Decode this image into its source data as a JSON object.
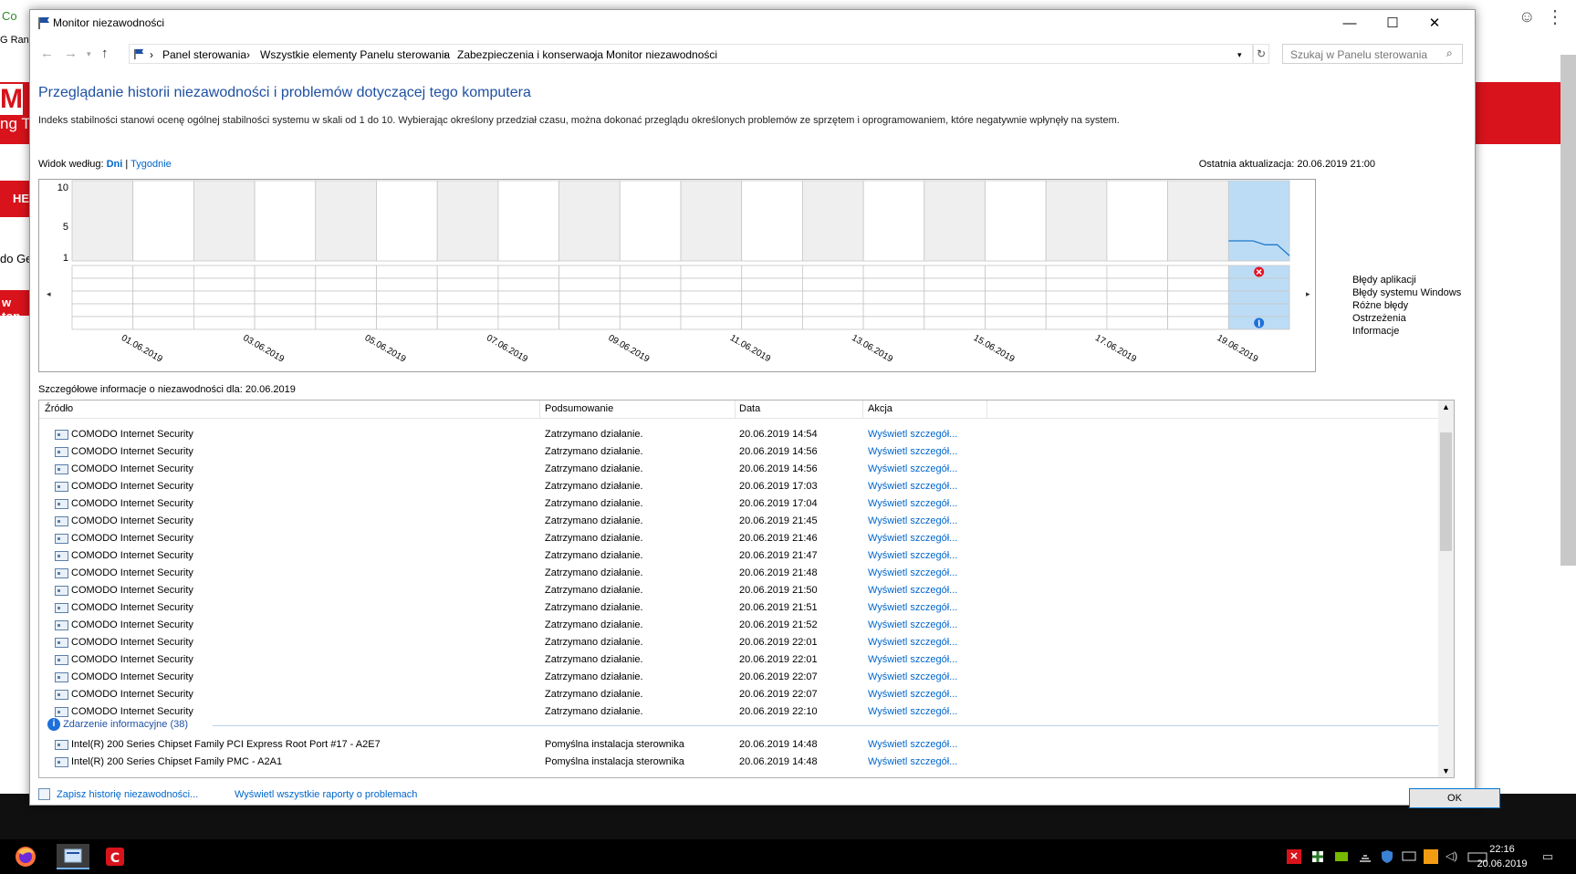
{
  "background": {
    "frag_tab": "Co",
    "frag_ran": "G Ran",
    "frag_ng": "ng T",
    "frag_he": "HE",
    "frag_do": "do Ge",
    "frag_top": "w top",
    "frag_m": "M"
  },
  "window": {
    "title": "Monitor niezawodności",
    "minimize": "—",
    "maximize": "☐",
    "close": "✕"
  },
  "address": {
    "crumbs": [
      "Panel sterowania",
      "Wszystkie elementy Panelu sterowania",
      "Zabezpieczenia i konserwacja",
      "Monitor niezawodności"
    ],
    "search_placeholder": "Szukaj w Panelu sterowania"
  },
  "page": {
    "heading": "Przeglądanie historii niezawodności i problemów dotyczącej tego komputera",
    "description": "Indeks stabilności stanowi ocenę ogólnej stabilności systemu w skali od 1 do 10. Wybierając określony przedział czasu, można dokonać przeglądu określonych problemów ze sprzętem i oprogramowaniem, które negatywnie wpłynęły na system.",
    "view_by_label": "Widok według:",
    "view_days": "Dni",
    "view_sep": "|",
    "view_weeks": "Tygodnie",
    "last_update": "Ostatnia aktualizacja: 20.06.2019 21:00"
  },
  "chart_data": {
    "type": "line",
    "title": "",
    "y_ticks": [
      "10",
      "5",
      "1"
    ],
    "ylim": [
      1,
      10
    ],
    "x_tick_labels": [
      "01.06.2019",
      "03.06.2019",
      "05.06.2019",
      "07.06.2019",
      "09.06.2019",
      "11.06.2019",
      "13.06.2019",
      "15.06.2019",
      "17.06.2019",
      "19.06.2019"
    ],
    "columns": 20,
    "selected_column": 19,
    "series": [
      {
        "x": [
          19.0,
          19.4,
          19.6,
          19.8,
          20.0
        ],
        "values": [
          3.1,
          3.1,
          2.6,
          2.6,
          1.2
        ]
      }
    ],
    "event_rows": [
      "Błędy aplikacji",
      "Błędy systemu Windows",
      "Różne błędy",
      "Ostrzeżenia",
      "Informacje"
    ],
    "markers": [
      {
        "row": 0,
        "column": 19,
        "kind": "error"
      },
      {
        "row": 4,
        "column": 19,
        "kind": "info"
      }
    ],
    "colors": {
      "selected": "#bcdcf6",
      "line": "#1f78c8",
      "error": "#e81123",
      "info": "#1e6fd9"
    }
  },
  "details": {
    "label": "Szczegółowe informacje o niezawodności dla: 20.06.2019",
    "headers": [
      "Źródło",
      "Podsumowanie",
      "Data",
      "Akcja"
    ],
    "rows": [
      {
        "source": "COMODO Internet Security",
        "summary": "Zatrzymano działanie.",
        "date": "20.06.2019 14:54",
        "action": "Wyświetl szczegół..."
      },
      {
        "source": "COMODO Internet Security",
        "summary": "Zatrzymano działanie.",
        "date": "20.06.2019 14:56",
        "action": "Wyświetl szczegół..."
      },
      {
        "source": "COMODO Internet Security",
        "summary": "Zatrzymano działanie.",
        "date": "20.06.2019 14:56",
        "action": "Wyświetl szczegół..."
      },
      {
        "source": "COMODO Internet Security",
        "summary": "Zatrzymano działanie.",
        "date": "20.06.2019 17:03",
        "action": "Wyświetl szczegół..."
      },
      {
        "source": "COMODO Internet Security",
        "summary": "Zatrzymano działanie.",
        "date": "20.06.2019 17:04",
        "action": "Wyświetl szczegół..."
      },
      {
        "source": "COMODO Internet Security",
        "summary": "Zatrzymano działanie.",
        "date": "20.06.2019 21:45",
        "action": "Wyświetl szczegół..."
      },
      {
        "source": "COMODO Internet Security",
        "summary": "Zatrzymano działanie.",
        "date": "20.06.2019 21:46",
        "action": "Wyświetl szczegół..."
      },
      {
        "source": "COMODO Internet Security",
        "summary": "Zatrzymano działanie.",
        "date": "20.06.2019 21:47",
        "action": "Wyświetl szczegół..."
      },
      {
        "source": "COMODO Internet Security",
        "summary": "Zatrzymano działanie.",
        "date": "20.06.2019 21:48",
        "action": "Wyświetl szczegół..."
      },
      {
        "source": "COMODO Internet Security",
        "summary": "Zatrzymano działanie.",
        "date": "20.06.2019 21:50",
        "action": "Wyświetl szczegół..."
      },
      {
        "source": "COMODO Internet Security",
        "summary": "Zatrzymano działanie.",
        "date": "20.06.2019 21:51",
        "action": "Wyświetl szczegół..."
      },
      {
        "source": "COMODO Internet Security",
        "summary": "Zatrzymano działanie.",
        "date": "20.06.2019 21:52",
        "action": "Wyświetl szczegół..."
      },
      {
        "source": "COMODO Internet Security",
        "summary": "Zatrzymano działanie.",
        "date": "20.06.2019 22:01",
        "action": "Wyświetl szczegół..."
      },
      {
        "source": "COMODO Internet Security",
        "summary": "Zatrzymano działanie.",
        "date": "20.06.2019 22:01",
        "action": "Wyświetl szczegół..."
      },
      {
        "source": "COMODO Internet Security",
        "summary": "Zatrzymano działanie.",
        "date": "20.06.2019 22:07",
        "action": "Wyświetl szczegół..."
      },
      {
        "source": "COMODO Internet Security",
        "summary": "Zatrzymano działanie.",
        "date": "20.06.2019 22:07",
        "action": "Wyświetl szczegół..."
      },
      {
        "source": "COMODO Internet Security",
        "summary": "Zatrzymano działanie.",
        "date": "20.06.2019 22:10",
        "action": "Wyświetl szczegół..."
      }
    ],
    "group_label": "Zdarzenie informacyjne (38)",
    "info_rows": [
      {
        "source": "Intel(R) 200 Series Chipset Family PCI Express Root Port #17 - A2E7",
        "summary": "Pomyślna instalacja sterownika",
        "date": "20.06.2019 14:48",
        "action": "Wyświetl szczegół..."
      },
      {
        "source": "Intel(R) 200 Series Chipset Family PMC - A2A1",
        "summary": "Pomyślna instalacja sterownika",
        "date": "20.06.2019 14:48",
        "action": "Wyświetl szczegół..."
      }
    ]
  },
  "footer": {
    "save_history": "Zapisz historię niezawodności...",
    "view_all_reports": "Wyświetl wszystkie raporty o problemach",
    "ok": "OK"
  },
  "taskbar": {
    "time": "22:16",
    "date": "20.06.2019"
  }
}
